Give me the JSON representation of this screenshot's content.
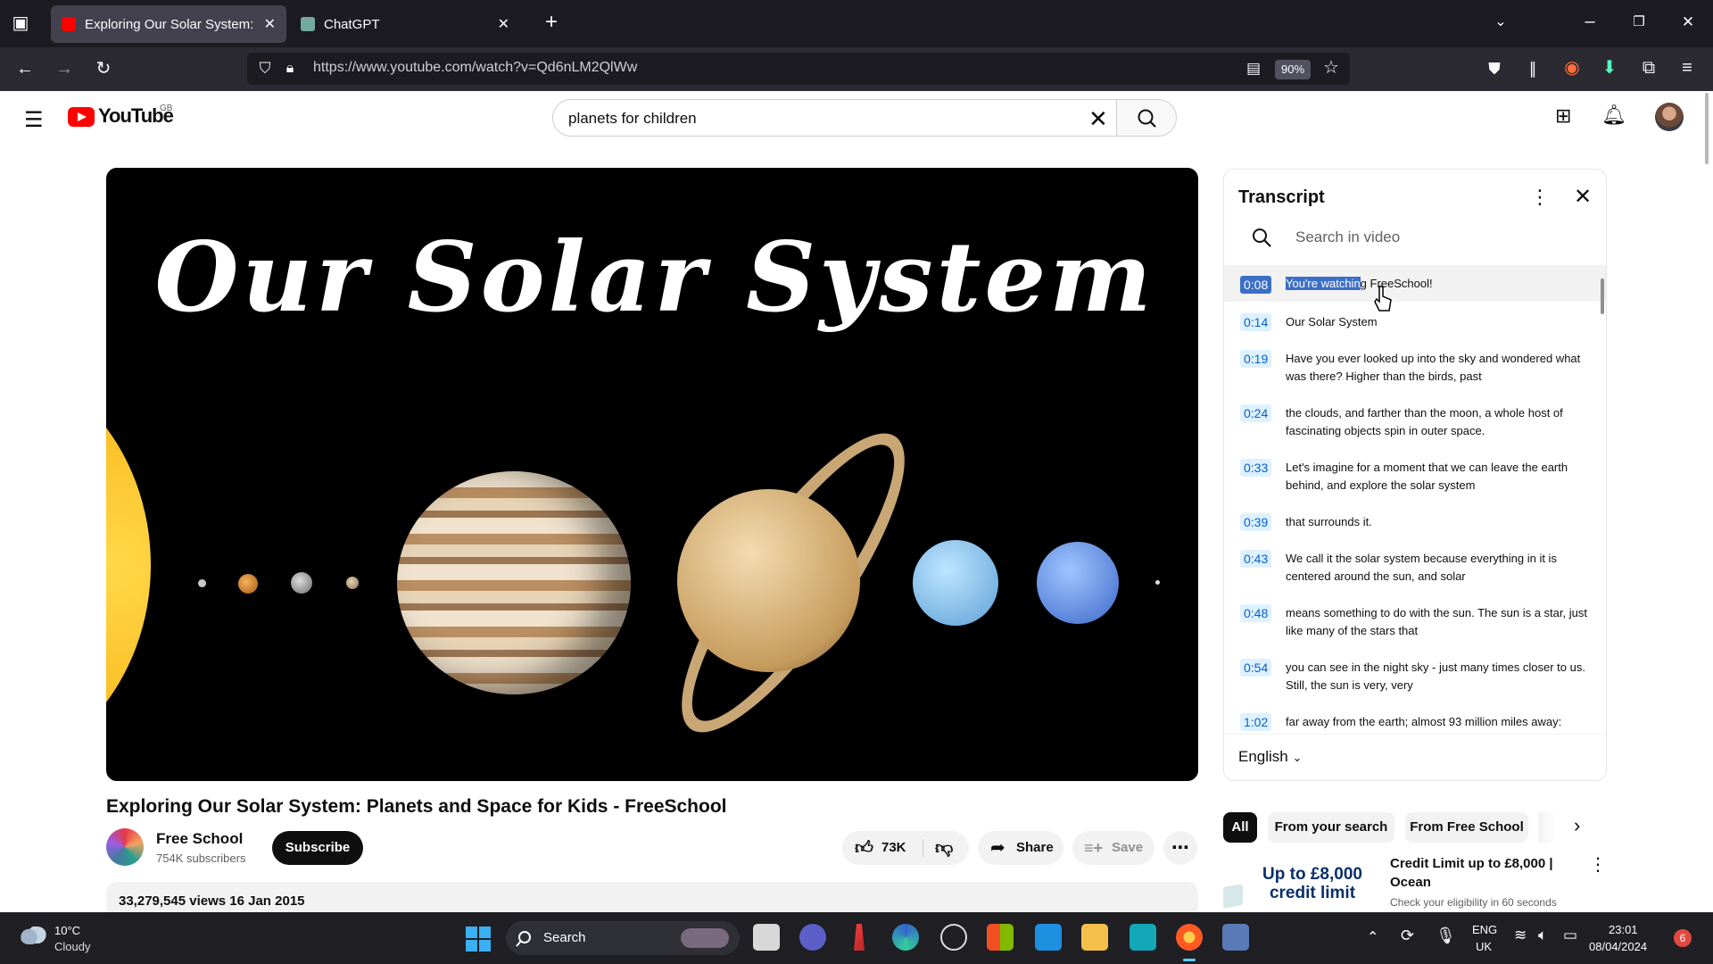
{
  "browser": {
    "tabs": [
      {
        "title": "Exploring Our Solar System: Pla",
        "active": true
      },
      {
        "title": "ChatGPT",
        "active": false
      }
    ],
    "url": "https://www.youtube.com/watch?v=Qd6nLM2QlWw",
    "zoom": "90%"
  },
  "youtube": {
    "logo_text": "YouTube",
    "region": "GB",
    "search_value": "planets for children"
  },
  "video": {
    "thumbnail_title": "Our Solar System",
    "title": "Exploring Our Solar System: Planets and Space for Kids - FreeSchool",
    "channel": "Free School",
    "subscribers": "754K subscribers",
    "subscribe_label": "Subscribe",
    "likes": "73K",
    "share_label": "Share",
    "save_label": "Save",
    "views_date": "33,279,545 views  16 Jan 2015"
  },
  "transcript": {
    "title": "Transcript",
    "search_placeholder": "Search in video",
    "language": "English",
    "segments": [
      {
        "time": "0:08",
        "text_hl": "You're watchin",
        "text_rest": "g FreeSchool!"
      },
      {
        "time": "0:14",
        "text": "Our Solar System"
      },
      {
        "time": "0:19",
        "text": "Have you ever looked up into the sky and wondered what was there? Higher than the birds, past"
      },
      {
        "time": "0:24",
        "text": "the clouds, and farther than the moon, a whole host of fascinating objects spin in outer space."
      },
      {
        "time": "0:33",
        "text": "Let's imagine for a moment that we can leave the earth behind, and explore the solar system"
      },
      {
        "time": "0:39",
        "text": "that surrounds it."
      },
      {
        "time": "0:43",
        "text": "We call it the solar system because everything in it is centered around the sun, and solar"
      },
      {
        "time": "0:48",
        "text": "means something to do with the sun. The sun is a star, just like many of the stars that"
      },
      {
        "time": "0:54",
        "text": "you can see in the night sky - just many times closer to us. Still, the sun is very, very"
      },
      {
        "time": "1:02",
        "text": "far away from the earth; almost 93 million miles away:"
      }
    ]
  },
  "chips": [
    "All",
    "From your search",
    "From Free School"
  ],
  "ad": {
    "thumb_line1": "Up to £8,000",
    "thumb_line2": "credit limit",
    "title": "Credit Limit up to £8,000 | Ocean",
    "subtitle": "Check your eligibility in 60 seconds"
  },
  "taskbar": {
    "weather_temp": "10°C",
    "weather_desc": "Cloudy",
    "search_label": "Search",
    "lang_line1": "ENG",
    "lang_line2": "UK",
    "time": "23:01",
    "date": "08/04/2024",
    "notif_count": "6"
  }
}
